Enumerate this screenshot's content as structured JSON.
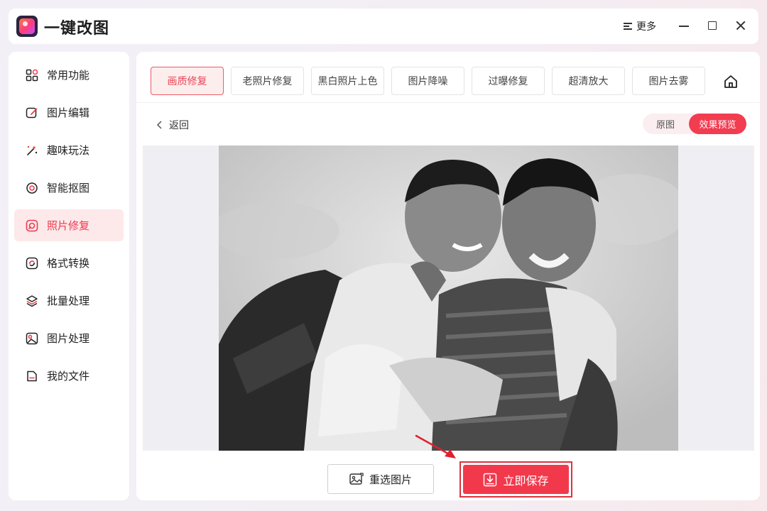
{
  "app": {
    "title": "一键改图",
    "more_label": "更多"
  },
  "sidebar": {
    "items": [
      {
        "label": "常用功能",
        "icon": "grid-icon"
      },
      {
        "label": "图片编辑",
        "icon": "edit-icon"
      },
      {
        "label": "趣味玩法",
        "icon": "magic-wand-icon"
      },
      {
        "label": "智能抠图",
        "icon": "target-icon"
      },
      {
        "label": "照片修复",
        "icon": "repair-icon",
        "active": true
      },
      {
        "label": "格式转换",
        "icon": "convert-icon"
      },
      {
        "label": "批量处理",
        "icon": "layers-icon"
      },
      {
        "label": "图片处理",
        "icon": "image-icon"
      },
      {
        "label": "我的文件",
        "icon": "file-icon"
      }
    ]
  },
  "tabs": [
    {
      "label": "画质修复",
      "active": true
    },
    {
      "label": "老照片修复"
    },
    {
      "label": "黑白照片上色"
    },
    {
      "label": "图片降噪"
    },
    {
      "label": "过曝修复"
    },
    {
      "label": "超清放大"
    },
    {
      "label": "图片去雾"
    }
  ],
  "toolbar": {
    "back_label": "返回",
    "toggle_original": "原图",
    "toggle_preview": "效果预览"
  },
  "actions": {
    "reselect_label": "重选图片",
    "save_label": "立即保存"
  },
  "colors": {
    "accent": "#f2394c",
    "active_bg": "#fde8ea"
  }
}
